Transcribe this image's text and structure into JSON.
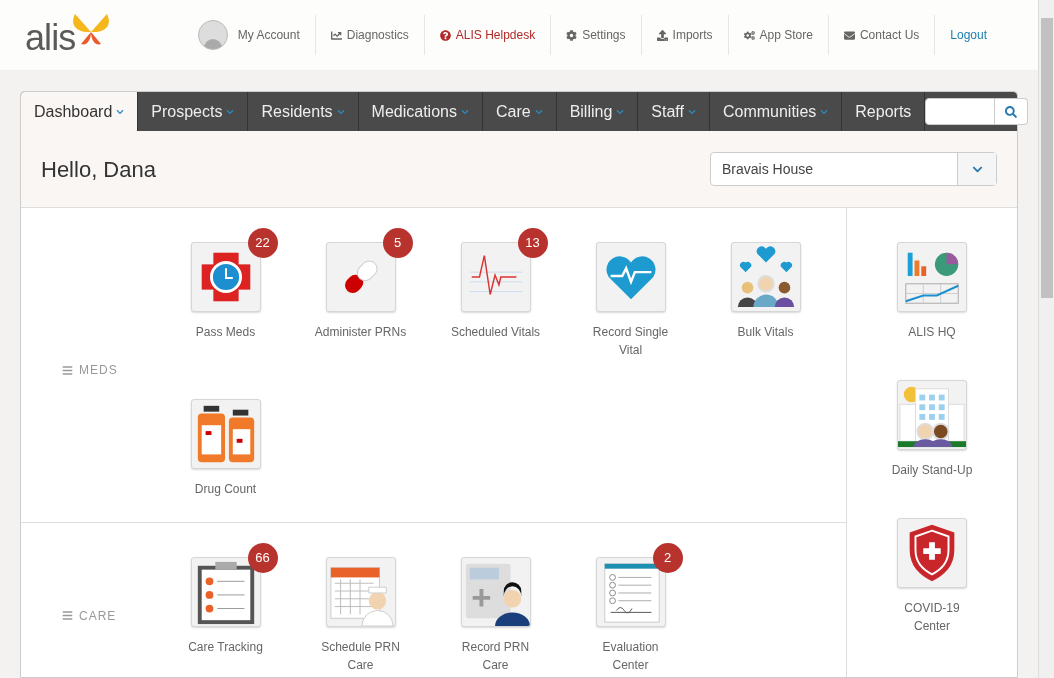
{
  "logo": {
    "text": "alis"
  },
  "top_links": [
    {
      "label": "My Account",
      "kind": "plain"
    },
    {
      "label": "Diagnostics",
      "kind": "plain"
    },
    {
      "label": "ALIS Helpdesk",
      "kind": "alert"
    },
    {
      "label": "Settings",
      "kind": "plain"
    },
    {
      "label": "Imports",
      "kind": "plain"
    },
    {
      "label": "App Store",
      "kind": "plain"
    },
    {
      "label": "Contact Us",
      "kind": "plain"
    },
    {
      "label": "Logout",
      "kind": "action"
    }
  ],
  "nav": [
    {
      "label": "Dashboard",
      "selected": true,
      "dropdown": true
    },
    {
      "label": "Prospects",
      "selected": false,
      "dropdown": true
    },
    {
      "label": "Residents",
      "selected": false,
      "dropdown": true
    },
    {
      "label": "Medications",
      "selected": false,
      "dropdown": true
    },
    {
      "label": "Care",
      "selected": false,
      "dropdown": true
    },
    {
      "label": "Billing",
      "selected": false,
      "dropdown": true
    },
    {
      "label": "Staff",
      "selected": false,
      "dropdown": true
    },
    {
      "label": "Communities",
      "selected": false,
      "dropdown": true
    },
    {
      "label": "Reports",
      "selected": false,
      "dropdown": false
    }
  ],
  "greeting": "Hello, Dana",
  "community_select": {
    "value": "Bravais House"
  },
  "sections": [
    {
      "title": "MEDS",
      "tiles": [
        {
          "label": "Pass Meds",
          "badge": "22"
        },
        {
          "label": "Administer PRNs",
          "badge": "5"
        },
        {
          "label": "Scheduled Vitals",
          "badge": "13"
        },
        {
          "label": "Record Single Vital"
        },
        {
          "label": "Bulk Vitals"
        },
        {
          "label": "Drug Count"
        }
      ]
    },
    {
      "title": "CARE",
      "tiles": [
        {
          "label": "Care Tracking",
          "badge": "66"
        },
        {
          "label": "Schedule PRN Care"
        },
        {
          "label": "Record PRN Care"
        },
        {
          "label": "Evaluation Center",
          "badge": "2"
        }
      ]
    }
  ],
  "side_tiles": [
    {
      "label": "ALIS HQ"
    },
    {
      "label": "Daily Stand-Up"
    },
    {
      "label": "COVID-19 Center"
    }
  ]
}
